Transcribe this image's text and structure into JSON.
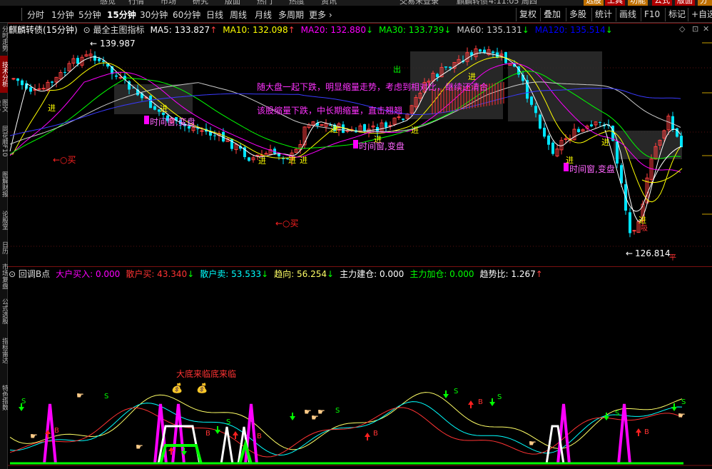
{
  "window": {
    "top_fragments": [
      "感觉",
      "行情",
      "市场",
      "研究",
      "版面",
      "热门",
      "热度",
      "资讯",
      "交易未登录",
      "麒麟转债",
      "4:11:05 周四"
    ]
  },
  "toolbar": {
    "periods": [
      "分时",
      "1分钟",
      "5分钟",
      "15分钟",
      "30分钟",
      "60分钟",
      "日线",
      "周线",
      "月线",
      "多周期",
      "更多 ›"
    ],
    "active_period": "15分钟",
    "right_buttons": [
      "复权",
      "叠加",
      "多股",
      "统计",
      "画线",
      "F10",
      "标记",
      "+自选"
    ],
    "badges": [
      {
        "label": "选股",
        "color": "#c07000"
      },
      {
        "label": "工具",
        "color": "#b00000"
      },
      {
        "label": "功能",
        "color": "#c07000"
      },
      {
        "label": "公式",
        "color": "#b00000"
      },
      {
        "label": "版面",
        "color": "#b00000"
      },
      {
        "label": "分析",
        "color": "#c07000"
      }
    ]
  },
  "left_tabs": [
    {
      "label": "分时走势",
      "active": false
    },
    {
      "label": "技术分析",
      "active": true
    },
    {
      "label": "图文F10",
      "active": false
    },
    {
      "label": "同花顺F10",
      "active": false
    },
    {
      "label": "图解财报",
      "active": false
    },
    {
      "label": "论股堂",
      "active": false
    },
    {
      "label": "日历",
      "active": false
    },
    {
      "label": "市场复盘",
      "active": false
    },
    {
      "label": "公式选股",
      "active": false
    },
    {
      "label": "指标雷达",
      "active": false
    },
    {
      "label": "特色指数",
      "active": false
    }
  ],
  "main_header": {
    "stock": "麒麟转债(15分钟)",
    "indicator": "最全主图指标",
    "ma": [
      {
        "label": "MA5: 133.827",
        "arrow": "↑",
        "color": "#ffffff"
      },
      {
        "label": "MA10: 132.098",
        "arrow": "↑",
        "color": "#ffff00"
      },
      {
        "label": "MA20: 132.880",
        "arrow": "↓",
        "color": "#ff00ff"
      },
      {
        "label": "MA30: 133.739",
        "arrow": "↓",
        "color": "#00ff00"
      },
      {
        "label": "MA60: 135.131",
        "arrow": "↓",
        "color": "#cccccc"
      },
      {
        "label": "MA120: 135.514",
        "arrow": "↓",
        "color": "#0000ff"
      }
    ]
  },
  "main_labels": {
    "high_price": "139.987",
    "low_price": "126.814",
    "buy_marks": [
      {
        "text": "←○买",
        "color": "#ff2222"
      },
      {
        "text": "←○买",
        "color": "#ff2222"
      }
    ],
    "jin": "进",
    "chu": "出",
    "pi": "平",
    "window_text": "时间窗,变盘",
    "overlay_text_1": "随大盘一起下跌，明显缩量走势，考虑到相对比，继续还清合",
    "overlay_text_2": "该股缩量下跌，中长期缩量，直击翘翘",
    "colors": {
      "up": "#ff4040",
      "down": "#00e5ff"
    }
  },
  "sub_header": {
    "indicator": "回调B点",
    "items": [
      {
        "label": "大户买入: 0.000",
        "color": "#ff00ff",
        "arrow": ""
      },
      {
        "label": "散户买: 43.340",
        "color": "#ff3333",
        "arrow": "↓"
      },
      {
        "label": "散户卖: 53.533",
        "color": "#00ffff",
        "arrow": "↓"
      },
      {
        "label": "趋向: 56.254",
        "color": "#ffff66",
        "arrow": "↓"
      },
      {
        "label": "主力建仓: 0.000",
        "color": "#ffffff",
        "arrow": ""
      },
      {
        "label": "主力加仓: 0.000",
        "color": "#00ff00",
        "arrow": ""
      },
      {
        "label": "趋势比: 1.267",
        "color": "#ffffff",
        "arrow": "↑"
      }
    ]
  },
  "sub_labels": {
    "big_bottom": "大底来临底来临",
    "b_mark": "B",
    "s_mark": "S",
    "money_icon": "money-bag-icon"
  }
}
